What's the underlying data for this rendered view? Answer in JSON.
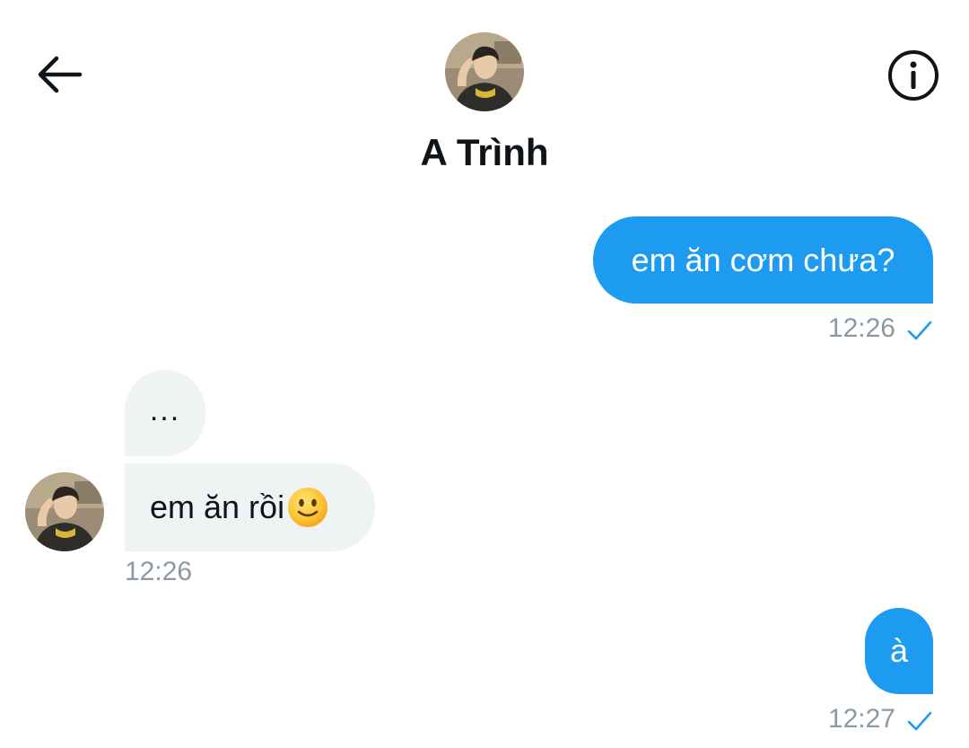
{
  "header": {
    "contact_name": "A Trình",
    "back_icon": "arrow-left-icon",
    "info_icon": "info-circle-icon"
  },
  "messages": [
    {
      "direction": "outgoing",
      "text": "em ăn cơm chưa?",
      "time": "12:26",
      "status_icon": "check-icon"
    },
    {
      "direction": "incoming",
      "text": "...",
      "time": ""
    },
    {
      "direction": "incoming",
      "text": "em ăn rồi",
      "emoji": "slightly-smiling-face-icon",
      "time": "12:26"
    },
    {
      "direction": "outgoing",
      "text": "à",
      "time": "12:27",
      "status_icon": "check-icon"
    }
  ],
  "colors": {
    "accent": "#1d9bf0",
    "incoming_bubble": "#eff3f4",
    "timestamp": "#8b98a5"
  }
}
